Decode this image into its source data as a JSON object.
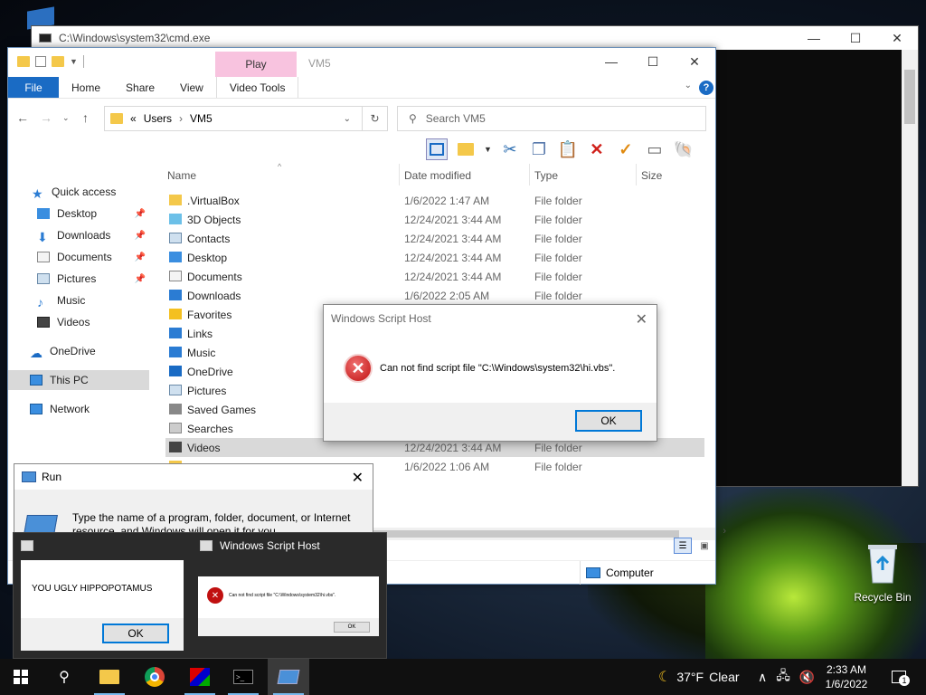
{
  "cmd": {
    "title": "C:\\Windows\\system32\\cmd.exe"
  },
  "explorer": {
    "title": "VM5",
    "contextual_tab": "Play",
    "tabs": [
      "File",
      "Home",
      "Share",
      "View",
      "Video Tools"
    ],
    "address": {
      "prefix": "«",
      "parts": [
        "Users",
        "VM5"
      ]
    },
    "search_placeholder": "Search VM5",
    "nav": [
      {
        "label": "Quick access",
        "pinned": false
      },
      {
        "label": "Desktop",
        "pinned": true
      },
      {
        "label": "Downloads",
        "pinned": true
      },
      {
        "label": "Documents",
        "pinned": true
      },
      {
        "label": "Pictures",
        "pinned": true
      },
      {
        "label": "Music",
        "pinned": false
      },
      {
        "label": "Videos",
        "pinned": false
      },
      {
        "label": "OneDrive",
        "pinned": false
      },
      {
        "label": "This PC",
        "pinned": false
      },
      {
        "label": "Network",
        "pinned": false
      }
    ],
    "columns": {
      "name": "Name",
      "date": "Date modified",
      "type": "Type",
      "size": "Size"
    },
    "rows": [
      {
        "name": ".VirtualBox",
        "date": "1/6/2022 1:47 AM",
        "type": "File folder"
      },
      {
        "name": "3D Objects",
        "date": "12/24/2021 3:44 AM",
        "type": "File folder"
      },
      {
        "name": "Contacts",
        "date": "12/24/2021 3:44 AM",
        "type": "File folder"
      },
      {
        "name": "Desktop",
        "date": "12/24/2021 3:44 AM",
        "type": "File folder"
      },
      {
        "name": "Documents",
        "date": "12/24/2021 3:44 AM",
        "type": "File folder"
      },
      {
        "name": "Downloads",
        "date": "1/6/2022 2:05 AM",
        "type": "File folder"
      },
      {
        "name": "Favorites",
        "date": "",
        "type": ""
      },
      {
        "name": "Links",
        "date": "",
        "type": ""
      },
      {
        "name": "Music",
        "date": "",
        "type": ""
      },
      {
        "name": "OneDrive",
        "date": "",
        "type": ""
      },
      {
        "name": "Pictures",
        "date": "",
        "type": ""
      },
      {
        "name": "Saved Games",
        "date": "",
        "type": ""
      },
      {
        "name": "Searches",
        "date": "",
        "type": ""
      },
      {
        "name": "Videos",
        "date": "12/24/2021 3:44 AM",
        "type": "File folder"
      },
      {
        "name": "",
        "date": "1/6/2022 1:06 AM",
        "type": "File folder"
      }
    ],
    "status_computer": "Computer"
  },
  "wsh_dialog": {
    "title": "Windows Script Host",
    "message": "Can not find script file \"C:\\Windows\\system32\\hi.vbs\".",
    "ok": "OK"
  },
  "run_dialog": {
    "title": "Run",
    "description": "Type the name of a program, folder, document, or Internet resource, and Windows will open it for you."
  },
  "preview": {
    "title": "Windows Script Host",
    "box1_message": "YOU UGLY HIPPOPOTAMUS",
    "box1_ok": "OK",
    "box2_message": "Can not find script file \"C:\\Windows\\system32\\hi.vbs\".",
    "box2_ok": "OK"
  },
  "desktop": {
    "recycle_bin": "Recycle Bin"
  },
  "taskbar": {
    "weather_temp": "37°F",
    "weather_desc": "Clear",
    "time": "2:33 AM",
    "date": "1/6/2022",
    "notifications": "1"
  },
  "colors": {
    "accent": "#1a6bc4",
    "play_tab": "#f8c3df",
    "error": "#c01010"
  }
}
